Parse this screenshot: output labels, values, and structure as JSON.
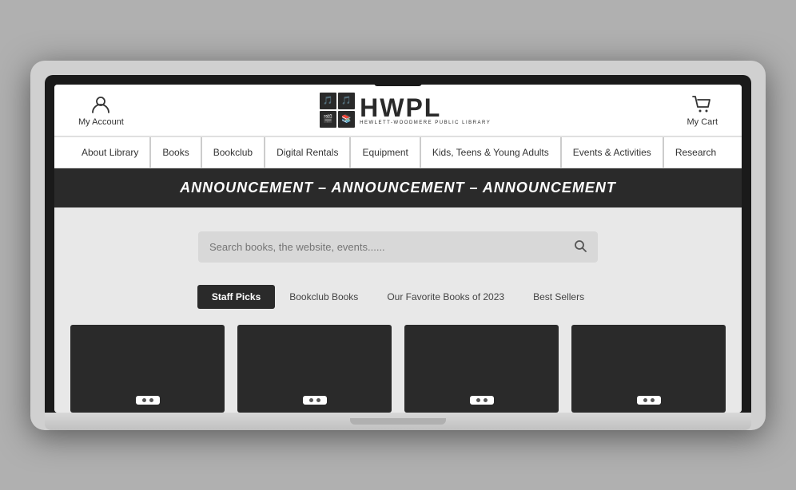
{
  "header": {
    "logo_hwpl": "HWPL",
    "logo_subtitle": "HEWLETT-WOODMERE PUBLIC LIBRARY",
    "account_label": "My Account",
    "cart_label": "My Cart"
  },
  "nav": {
    "items": [
      {
        "label": "About Library"
      },
      {
        "label": "Books"
      },
      {
        "label": "Bookclub"
      },
      {
        "label": "Digital Rentals"
      },
      {
        "label": "Equipment"
      },
      {
        "label": "Kids, Teens & Young Adults"
      },
      {
        "label": "Events & Activities"
      },
      {
        "label": "Research"
      }
    ]
  },
  "announcement": {
    "text": "ANNOUNCEMENT – ANNOUNCEMENT – ANNOUNCEMENT"
  },
  "search": {
    "placeholder": "Search books, the website, events......"
  },
  "books_tabs": {
    "items": [
      {
        "label": "Staff Picks",
        "active": true
      },
      {
        "label": "Bookclub Books",
        "active": false
      },
      {
        "label": "Our Favorite Books of 2023",
        "active": false
      },
      {
        "label": "Best Sellers",
        "active": false
      }
    ]
  },
  "book_cards": [
    {
      "id": 1
    },
    {
      "id": 2
    },
    {
      "id": 3
    },
    {
      "id": 4
    }
  ],
  "icons": {
    "account": "&#9711;",
    "cart": "&#128722;",
    "search": "&#128269;"
  }
}
